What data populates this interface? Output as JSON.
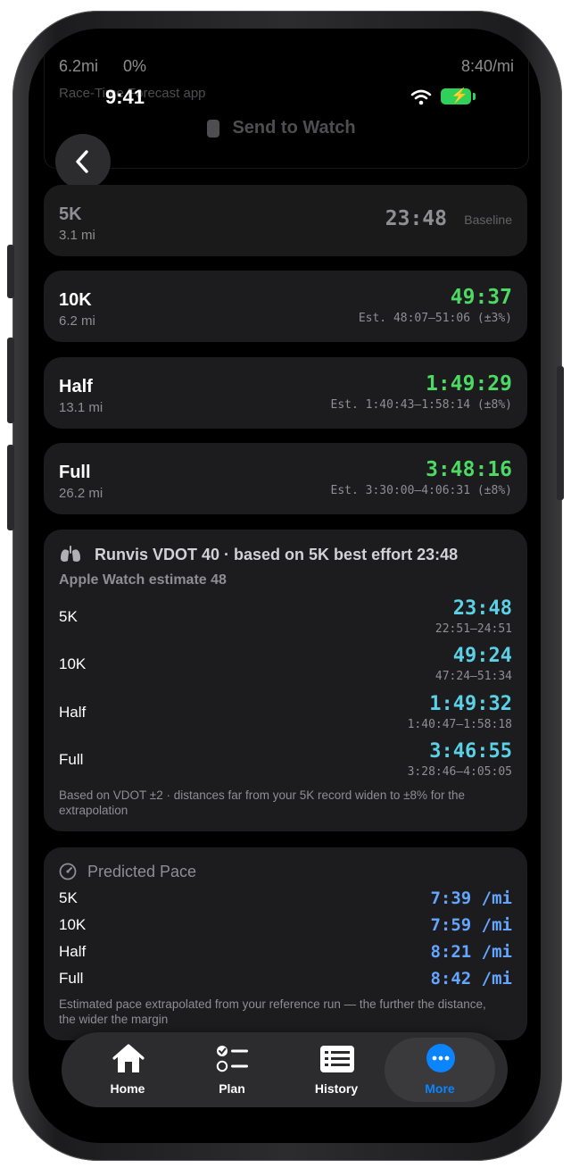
{
  "status_bar": {
    "time": "9:41"
  },
  "behind_header": {
    "stat_left": "6.2mi",
    "stat_mid": "0%",
    "stat_right": "8:40/mi",
    "forecast_text": "Race-Time Forecast app",
    "send_to_watch": "Send to Watch"
  },
  "races": [
    {
      "name": "5K",
      "distance": "3.1 mi",
      "time": "23:48",
      "note": "Baseline"
    },
    {
      "name": "10K",
      "distance": "6.2 mi",
      "time": "49:37",
      "note": "Est. 48:07–51:06 (±3%)"
    },
    {
      "name": "Half",
      "distance": "13.1 mi",
      "time": "1:49:29",
      "note": "Est. 1:40:43–1:58:14 (±8%)"
    },
    {
      "name": "Full",
      "distance": "26.2 mi",
      "time": "3:48:16",
      "note": "Est. 3:30:00–4:06:31 (±8%)"
    }
  ],
  "vdot": {
    "title": "Runvis VDOT 40 · based on 5K best effort 23:48",
    "subtitle": "Apple Watch estimate 48",
    "rows": [
      {
        "label": "5K",
        "time": "23:48",
        "range": "22:51–24:51"
      },
      {
        "label": "10K",
        "time": "49:24",
        "range": "47:24–51:34"
      },
      {
        "label": "Half",
        "time": "1:49:32",
        "range": "1:40:47–1:58:18"
      },
      {
        "label": "Full",
        "time": "3:46:55",
        "range": "3:28:46–4:05:05"
      }
    ],
    "note": "Based on VDOT ±2 · distances far from your 5K record widen to ±8% for the extrapolation"
  },
  "pace": {
    "title": "Predicted Pace",
    "rows": [
      {
        "label": "5K",
        "value": "7:39 /mi"
      },
      {
        "label": "10K",
        "value": "7:59 /mi"
      },
      {
        "label": "Half",
        "value": "8:21 /mi"
      },
      {
        "label": "Full",
        "value": "8:42 /mi"
      }
    ],
    "note": "Estimated pace extrapolated from your reference run — the further the distance, the wider the margin"
  },
  "tabs": [
    {
      "label": "Home",
      "icon": "house-icon"
    },
    {
      "label": "Plan",
      "icon": "checklist-icon"
    },
    {
      "label": "History",
      "icon": "list-icon"
    },
    {
      "label": "More",
      "icon": "ellipsis-icon"
    }
  ],
  "colors": {
    "background": "#000000",
    "card": "#1c1c1e",
    "green_time": "#4cd964",
    "cyan_time": "#5ad1e6",
    "blue_pace": "#64a6ff",
    "active_tab": "#0a84ff",
    "secondary_text": "#8e8e93"
  }
}
